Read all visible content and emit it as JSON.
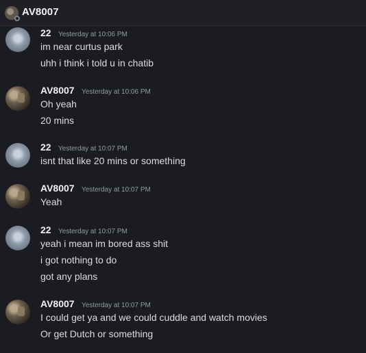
{
  "header": {
    "title": "AV8007",
    "avatar_icon": "user-avatar-icon"
  },
  "messages": [
    {
      "author": "22",
      "timestamp": "Yesterday at 10:06 PM",
      "lines": [
        "im near curtus park",
        "uhh i think i told u in chatib"
      ]
    },
    {
      "author": "AV8007",
      "timestamp": "Yesterday at 10:06 PM",
      "lines": [
        "Oh yeah",
        "20 mins"
      ]
    },
    {
      "author": "22",
      "timestamp": "Yesterday at 10:07 PM",
      "lines": [
        "isnt that like 20 mins or something"
      ]
    },
    {
      "author": "AV8007",
      "timestamp": "Yesterday at 10:07 PM",
      "lines": [
        "Yeah"
      ]
    },
    {
      "author": "22",
      "timestamp": "Yesterday at 10:07 PM",
      "lines": [
        "yeah i mean im bored ass shit",
        "i got nothing to do",
        "got any plans"
      ]
    },
    {
      "author": "AV8007",
      "timestamp": "Yesterday at 10:07 PM",
      "lines": [
        "I could get ya and we could cuddle and watch movies",
        "Or get Dutch or something"
      ]
    }
  ]
}
